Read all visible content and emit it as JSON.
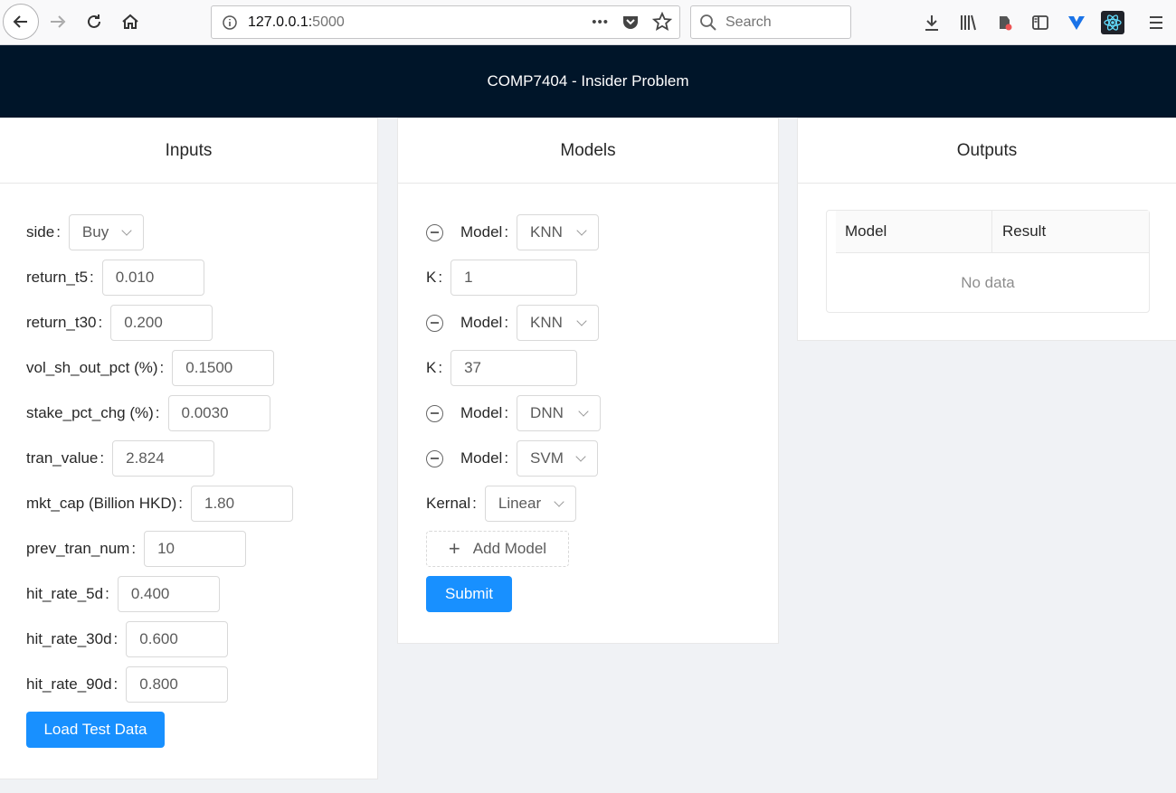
{
  "browser": {
    "url_host": "127.0.0.1:",
    "url_port": "5000",
    "search_placeholder": "Search",
    "more_label": "•••"
  },
  "app": {
    "title": "COMP7404 - Insider Problem"
  },
  "inputs": {
    "title": "Inputs",
    "fields": [
      {
        "label": "side",
        "value": "Buy",
        "type": "select"
      },
      {
        "label": "return_t5",
        "value": "0.010"
      },
      {
        "label": "return_t30",
        "value": "0.200"
      },
      {
        "label": "vol_sh_out_pct (%)",
        "value": "0.1500"
      },
      {
        "label": "stake_pct_chg (%)",
        "value": "0.0030"
      },
      {
        "label": "tran_value",
        "value": "2.824"
      },
      {
        "label": "mkt_cap (Billion HKD)",
        "value": "1.80"
      },
      {
        "label": "prev_tran_num",
        "value": "10"
      },
      {
        "label": "hit_rate_5d",
        "value": "0.400"
      },
      {
        "label": "hit_rate_30d",
        "value": "0.600"
      },
      {
        "label": "hit_rate_90d",
        "value": "0.800"
      }
    ],
    "colon": ":",
    "load_button": "Load Test Data"
  },
  "models": {
    "title": "Models",
    "model_label": "Model",
    "k_label": "K",
    "kernal_label": "Kernal",
    "model1": "KNN",
    "k1": "1",
    "model2": "KNN",
    "k2": "37",
    "model3": "DNN",
    "model4": "SVM",
    "kernal": "Linear",
    "add_model": "Add Model",
    "submit": "Submit"
  },
  "outputs": {
    "title": "Outputs",
    "columns": [
      "Model",
      "Result"
    ],
    "empty_text": "No data"
  }
}
